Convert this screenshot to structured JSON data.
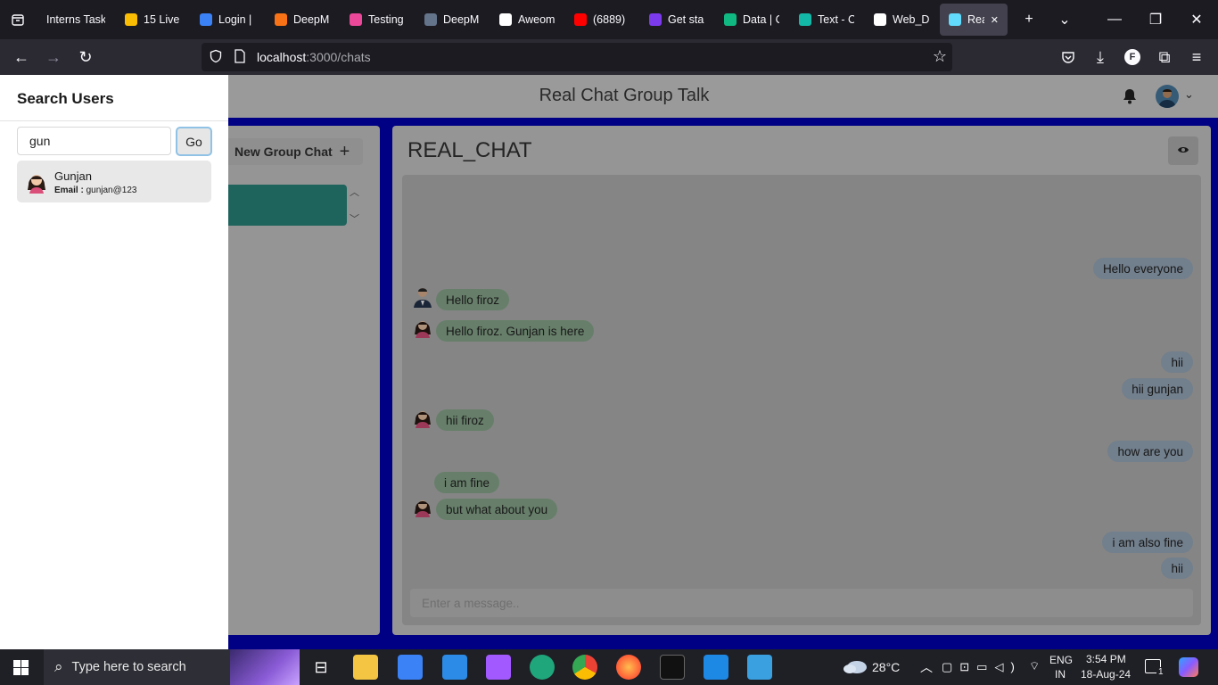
{
  "browser": {
    "tabs": [
      {
        "label": "Interns Task",
        "color": "#1c1b22"
      },
      {
        "label": "15 Live",
        "color": "#fbbc04"
      },
      {
        "label": "Login |",
        "color": "#3b82f6"
      },
      {
        "label": "DeepM",
        "color": "#f97316"
      },
      {
        "label": "Testing",
        "color": "#ec4899"
      },
      {
        "label": "DeepM",
        "color": "#64748b"
      },
      {
        "label": "Aweom",
        "color": "#ffffff"
      },
      {
        "label": "(6889)",
        "color": "#ff0000"
      },
      {
        "label": "Get star",
        "color": "#7c3aed"
      },
      {
        "label": "Data | C",
        "color": "#10b981"
      },
      {
        "label": "Text - C",
        "color": "#14b8a6"
      },
      {
        "label": "Web_D",
        "color": "#ffffff"
      },
      {
        "label": "Real",
        "color": "#61dafb"
      }
    ],
    "url_host": "localhost",
    "url_path": ":3000/chats"
  },
  "app": {
    "header_title": "Real Chat Group Talk",
    "new_group_label": "New Group Chat",
    "chat_title": "REAL_CHAT",
    "message_placeholder": "Enter a message..",
    "messages": [
      {
        "text": "Hello everyone",
        "side": "right"
      },
      {
        "text": "Hello firoz",
        "side": "left",
        "avatar": "male"
      },
      {
        "text": "Hello firoz. Gunjan is here",
        "side": "left",
        "avatar": "female"
      },
      {
        "text": "hii",
        "side": "right"
      },
      {
        "text": "hii gunjan",
        "side": "right"
      },
      {
        "text": "hii firoz",
        "side": "left",
        "avatar": "female"
      },
      {
        "text": "how are you",
        "side": "right"
      },
      {
        "text": "i am fine",
        "side": "left"
      },
      {
        "text": "but what about you",
        "side": "left",
        "avatar": "female"
      },
      {
        "text": "i am also fine",
        "side": "right"
      },
      {
        "text": "hii",
        "side": "right"
      }
    ]
  },
  "drawer": {
    "title": "Search Users",
    "search_value": "gun",
    "go_label": "Go",
    "result": {
      "name": "Gunjan",
      "email_label": "Email :",
      "email": "gunjan@123"
    }
  },
  "taskbar": {
    "search_placeholder": "Type here to search",
    "temperature": "28°C",
    "lang_line1": "ENG",
    "lang_line2": "IN",
    "time": "3:54 PM",
    "date": "18-Aug-24",
    "notification_count": "1"
  },
  "colors": {
    "page_bg": "#0000b8",
    "chat_selected": "#2a9d8f"
  }
}
